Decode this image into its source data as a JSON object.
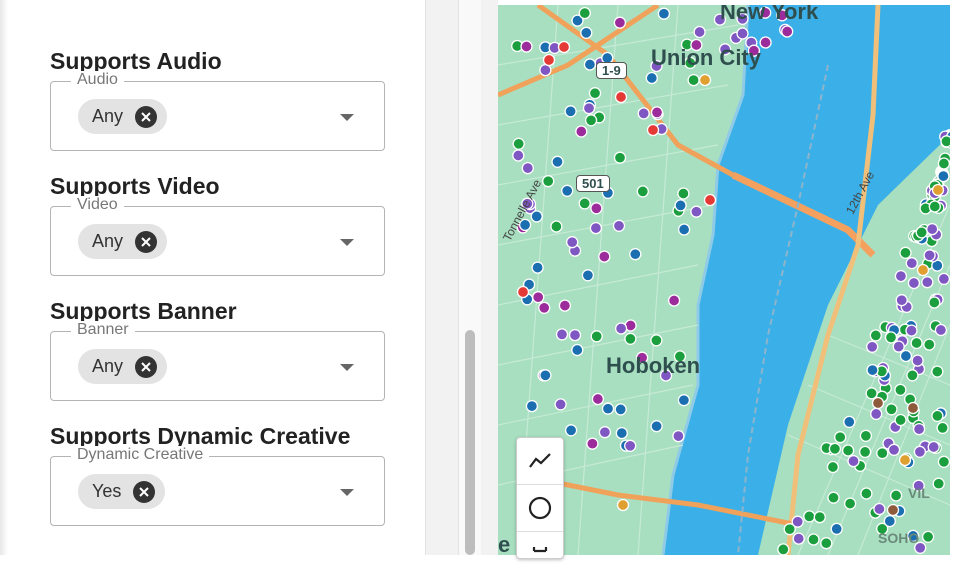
{
  "filters": [
    {
      "title": "Supports Audio",
      "legend": "Audio",
      "value": "Any"
    },
    {
      "title": "Supports Video",
      "legend": "Video",
      "value": "Any"
    },
    {
      "title": "Supports Banner",
      "legend": "Banner",
      "value": "Any"
    },
    {
      "title": "Supports Dynamic Creative",
      "legend": "Dynamic Creative",
      "value": "Yes"
    }
  ],
  "map": {
    "labels": {
      "new_york": "New York",
      "union_city": "Union City",
      "hoboken": "Hoboken",
      "jersey_city": "e City",
      "village": "VIL",
      "soho": "SOHO",
      "route_19": "1-9",
      "route_501": "501",
      "tonnelle": "Tonnelle Ave",
      "twelfth_ave": "12th Ave"
    },
    "marker_colors": {
      "green": "#1b9e3e",
      "blue": "#1b6fb0",
      "purple": "#7e57c2",
      "magenta": "#9c2c9c",
      "red": "#e53935",
      "orange": "#e0a030",
      "brown": "#8d5a3b"
    },
    "tools": [
      "trend-line-icon",
      "circle-icon",
      "ruler-icon"
    ]
  }
}
